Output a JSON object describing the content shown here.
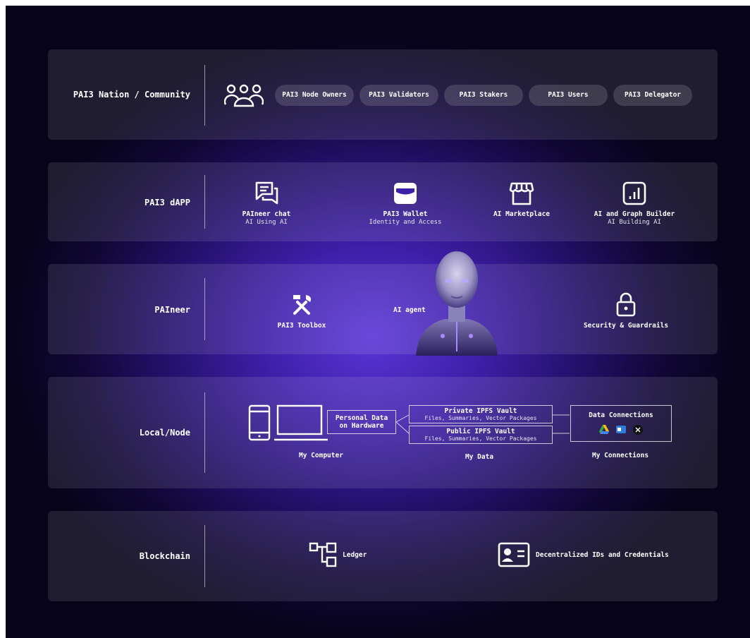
{
  "rows": {
    "community": {
      "label": "PAI3 Nation / Community",
      "pills": [
        "PAI3 Node Owners",
        "PAI3 Validators",
        "PAI3 Stakers",
        "PAI3 Users",
        "PAI3 Delegator"
      ]
    },
    "dapp": {
      "label": "PAI3 dAPP",
      "items": [
        {
          "title": "PAIneer chat",
          "subtitle": "AI Using AI",
          "icon": "chat-icon"
        },
        {
          "title": "PAI3 Wallet",
          "subtitle": "Identity and Access",
          "icon": "wallet-icon"
        },
        {
          "title": "AI Marketplace",
          "subtitle": "",
          "icon": "store-icon"
        },
        {
          "title": "AI and Graph Builder",
          "subtitle": "AI Building AI",
          "icon": "chart-icon"
        }
      ]
    },
    "paineer": {
      "label": "PAIneer",
      "toolbox": "PAI3 Toolbox",
      "agent": "AI agent",
      "security": "Security & Guardrails"
    },
    "local": {
      "label": "Local/Node",
      "personal_data": [
        "Personal Data",
        "on Hardware"
      ],
      "private_vault": {
        "title": "Private IPFS Vault",
        "subtitle": "Files, Summaries, Vector Packages"
      },
      "public_vault": {
        "title": "Public IPFS Vault",
        "subtitle": "Files, Summaries, Vector Packages"
      },
      "connections": "Data Connections",
      "captions": {
        "computer": "My Computer",
        "data": "My Data",
        "connections": "My Connections"
      }
    },
    "blockchain": {
      "label": "Blockchain",
      "ledger": "Ledger",
      "ids": "Decentralized IDs and Credentials"
    }
  },
  "colors": {
    "accent": "#5a35d6",
    "background": "#07041a",
    "band": "rgba(255,255,255,0.10)"
  }
}
